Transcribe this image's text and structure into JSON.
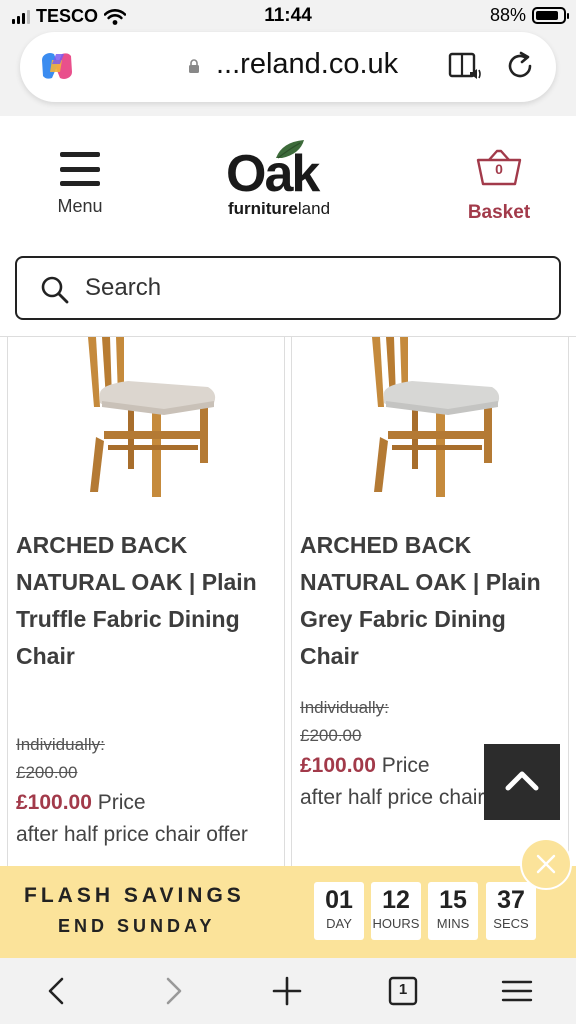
{
  "status_bar": {
    "carrier": "TESCO",
    "time": "11:44",
    "battery": "88%"
  },
  "browser": {
    "url": "...reland.co.uk"
  },
  "header": {
    "menu_label": "Menu",
    "logo_main": "Oak",
    "logo_sub_bold": "furniture",
    "logo_sub_light": "land",
    "basket_count": "0",
    "basket_label": "Basket"
  },
  "search": {
    "placeholder": "Search"
  },
  "products": [
    {
      "title": "ARCHED BACK NATURAL OAK | Plain Truffle Fabric Dining Chair",
      "was_label": "Individually:",
      "was_price": "£200.00",
      "price": "£100.00",
      "price_suffix": "Price",
      "offer": "after half price chair offer",
      "seat_color": "#dcd6cf"
    },
    {
      "title": "ARCHED BACK NATURAL OAK | Plain Grey Fabric Dining Chair",
      "was_label": "Individually:",
      "was_price": "£200.00",
      "price": "£100.00",
      "price_suffix": "Price",
      "offer": "after half price chair offer",
      "seat_color": "#d7d7d5"
    }
  ],
  "flash_banner": {
    "line1": "FLASH SAVINGS",
    "line2": "END SUNDAY",
    "countdown": [
      {
        "value": "01",
        "unit": "DAY"
      },
      {
        "value": "12",
        "unit": "HOURS"
      },
      {
        "value": "15",
        "unit": "MINS"
      },
      {
        "value": "37",
        "unit": "SECS"
      }
    ]
  },
  "toolbar": {
    "tab_count": "1"
  },
  "colors": {
    "brand_accent": "#a23a4a",
    "banner_bg": "#fbe39a"
  }
}
